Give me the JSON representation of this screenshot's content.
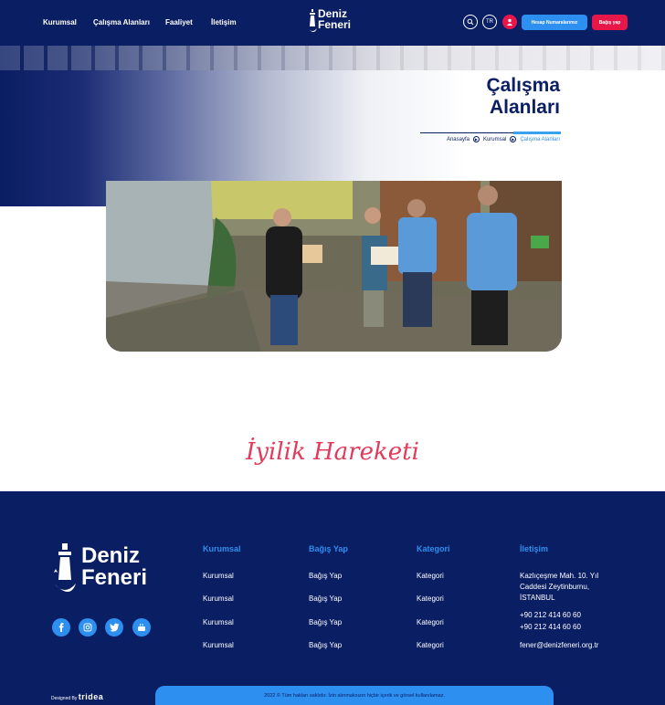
{
  "nav": {
    "items": [
      "Kurumsal",
      "Çalışma Alanları",
      "Faaliyet",
      "İletişim"
    ],
    "logo_line1": "Deniz",
    "logo_line2": "Feneri",
    "language": "TR",
    "account_button": "Hesap Numaralarımız",
    "donate_button": "Bağış yap"
  },
  "hero": {
    "title_line1": "Çalışma",
    "title_line2": "Alanları",
    "breadcrumb": [
      "Anasayfa",
      "Kurumsal",
      "Çalışma Alanları"
    ]
  },
  "tagline": "İyilik Hareketi",
  "footer": {
    "logo_line1": "Deniz",
    "logo_line2": "Feneri",
    "columns": [
      {
        "title": "Kurumsal",
        "items": [
          "Kurumsal",
          "Kurumsal",
          "Kurumsal",
          "Kurumsal"
        ]
      },
      {
        "title": "Bağış Yap",
        "items": [
          "Bağış Yap",
          "Bağış Yap",
          "Bağış Yap",
          "Bağış Yap"
        ]
      },
      {
        "title": "Kategori",
        "items": [
          "Kategori",
          "Kategori",
          "Kategori",
          "Kategori"
        ]
      }
    ],
    "contact": {
      "title": "İletişim",
      "address_line1": "Kazlıçeşme Mah. 10. Yıl",
      "address_line2": "Caddesi Zeytinburnu,",
      "address_line3": "İSTANBUL",
      "phone1": "+90 212 414 60 60",
      "phone2": "+90 212 414 60 60",
      "email": "fener@denizfeneri.org.tr"
    },
    "designed_by_label": "Designed By",
    "designed_by_brand": "tridea",
    "copyright": "2022 © Tüm hakları saklıdır. İzin alınmaksızın hiçbir içerik ve görsel kullanılamaz."
  },
  "colors": {
    "navy": "#0a1e63",
    "accent_blue": "#2d8ff0",
    "accent_red": "#e8174a",
    "tagline_red": "#e23a5a"
  },
  "icons": [
    "search-icon",
    "user-icon",
    "play-circle-icon",
    "facebook-icon",
    "instagram-icon",
    "twitter-icon",
    "youtube-icon",
    "lighthouse-icon"
  ]
}
